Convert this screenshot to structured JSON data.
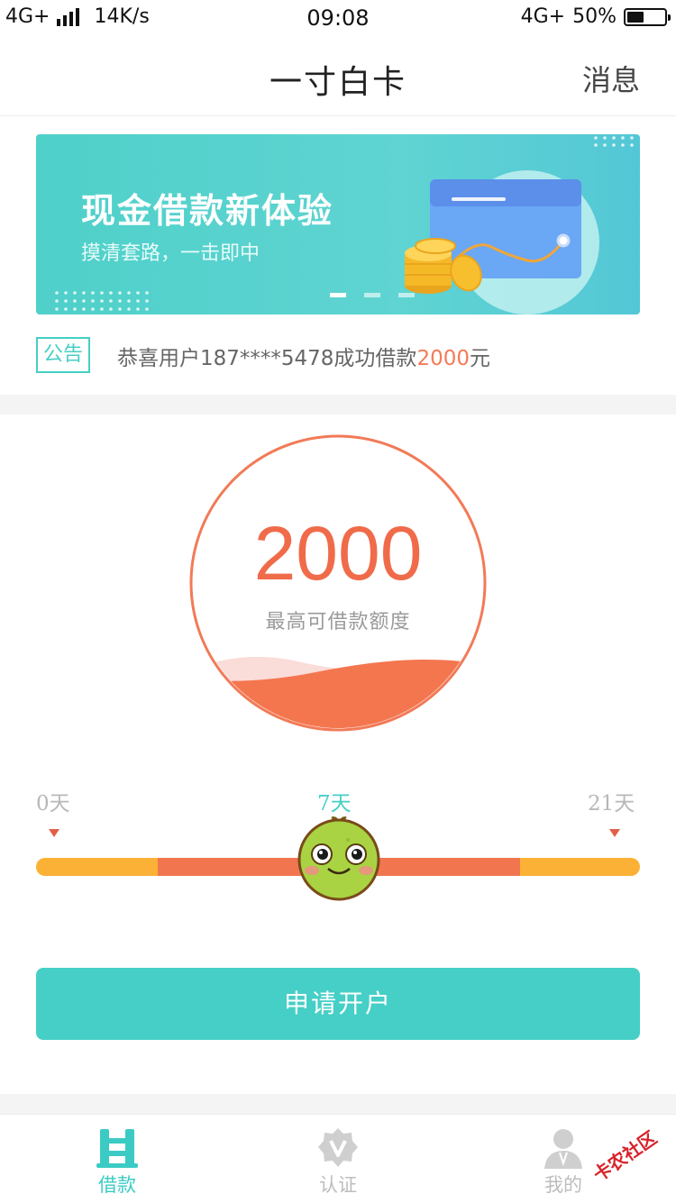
{
  "status_bar": {
    "network_left": "4G+",
    "speed": "14K/s",
    "time": "09:08",
    "network_right": "4G+",
    "battery_text": "50%",
    "battery_level": 0.5
  },
  "header": {
    "title": "一寸白卡",
    "messages_label": "消息"
  },
  "banner": {
    "title": "现金借款新体验",
    "subtitle": "摸清套路，一击即中",
    "active_slide": 1,
    "slide_count": 3
  },
  "notice": {
    "tag": "公告",
    "text_prefix": "恭喜用户187****5478成功借款",
    "amount": "2000",
    "text_suffix": "元"
  },
  "credit": {
    "amount": "2000",
    "label": "最高可借款额度"
  },
  "term_slider": {
    "min_label": "0天",
    "current_label": "7天",
    "max_label": "21天",
    "current_value": 7,
    "max_value": 21
  },
  "apply_button": {
    "label": "申请开户"
  },
  "tabbar": {
    "tabs": [
      {
        "label": "借款",
        "icon": "loan-icon",
        "active": true
      },
      {
        "label": "认证",
        "icon": "verify-badge-icon",
        "active": false
      },
      {
        "label": "我的",
        "icon": "user-profile-icon",
        "active": false
      }
    ]
  },
  "watermark": {
    "text": "卡农社区"
  },
  "colors": {
    "accent": "#46cfc6",
    "orange": "#f06b4a",
    "track_yellow": "#fbb135",
    "inactive": "#c8c8c8"
  }
}
